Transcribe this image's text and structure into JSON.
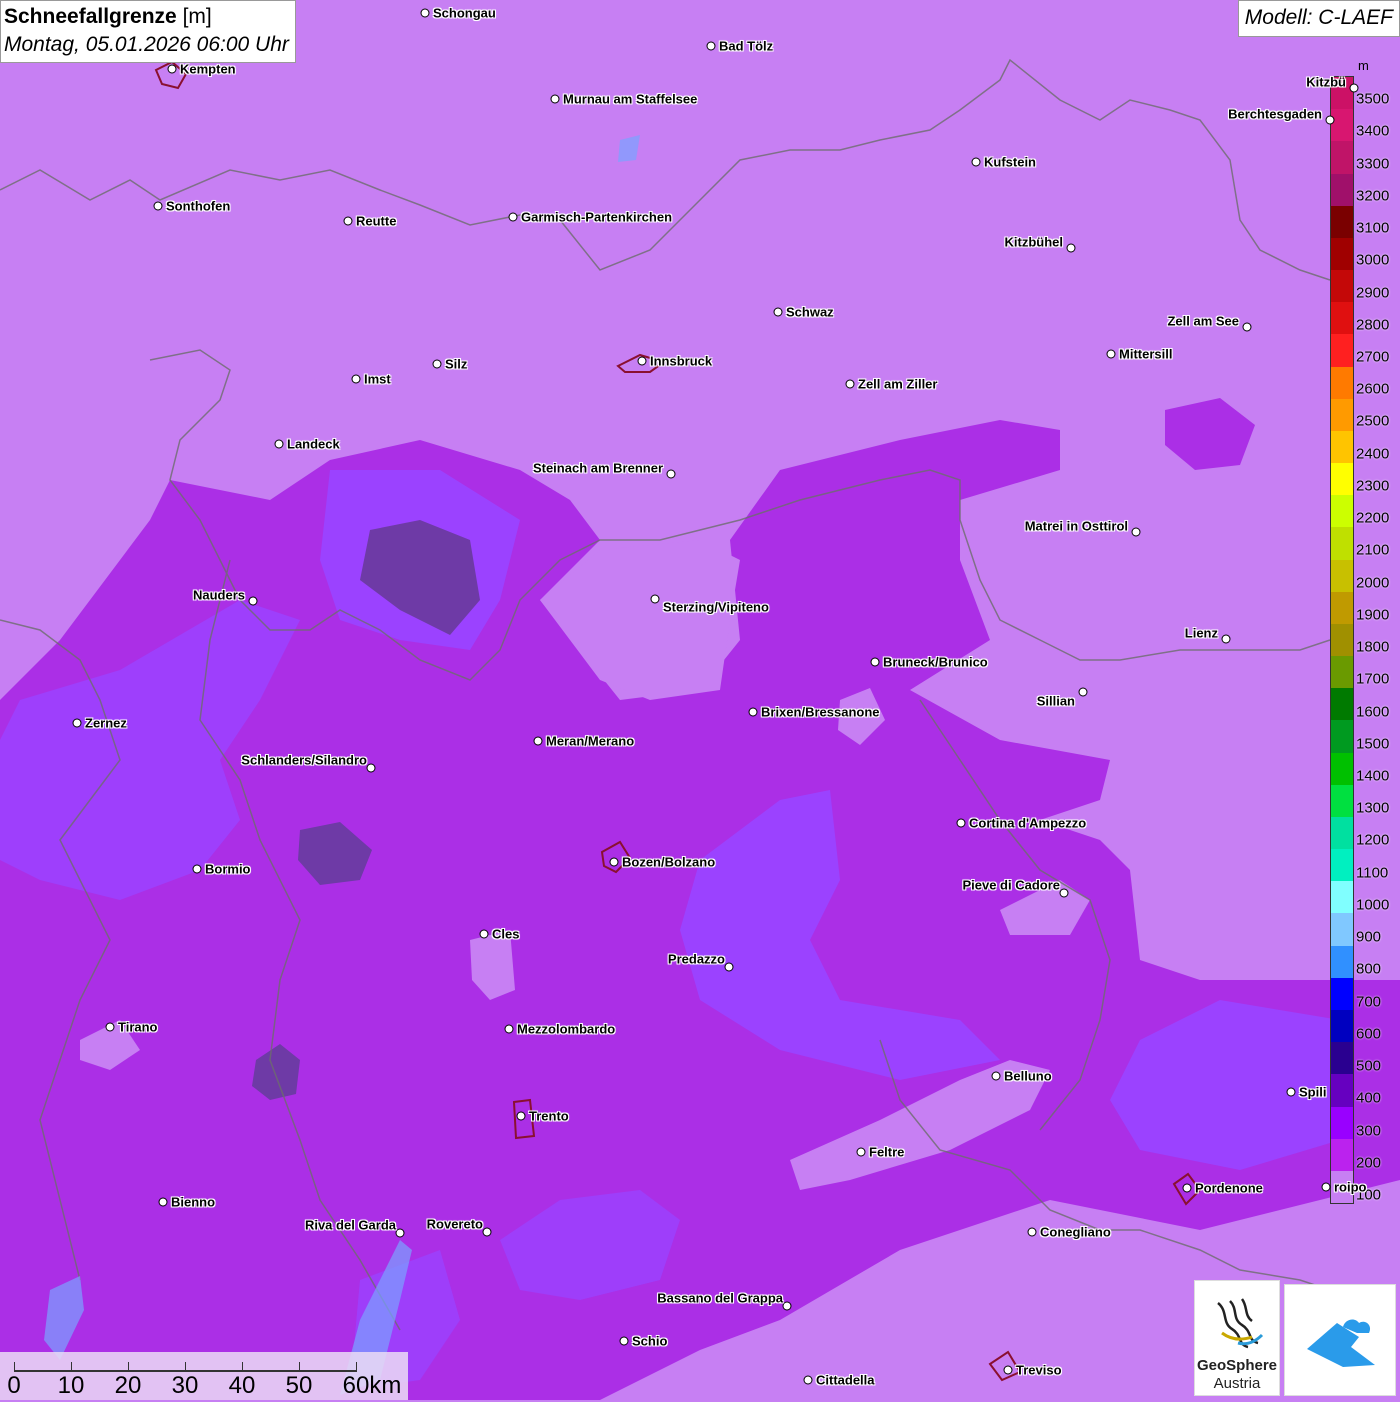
{
  "title": {
    "main": "Schneefallgrenze",
    "unit": "[m]",
    "subtitle": "Montag, 05.01.2026 06:00 Uhr"
  },
  "model": "Modell: C-LAEF",
  "legend": {
    "unit": "m",
    "labels": [
      "3500",
      "3400",
      "3300",
      "3200",
      "3100",
      "3000",
      "2900",
      "2800",
      "2700",
      "2600",
      "2500",
      "2400",
      "2300",
      "2200",
      "2100",
      "2000",
      "1900",
      "1800",
      "1700",
      "1600",
      "1500",
      "1400",
      "1300",
      "1200",
      "1100",
      "1000",
      "900",
      "800",
      "700",
      "600",
      "500",
      "400",
      "300",
      "200",
      "100"
    ],
    "colors": [
      "#cc1166",
      "#d81670",
      "#c01468",
      "#a0106a",
      "#7a0000",
      "#a00000",
      "#c40808",
      "#e01010",
      "#ff2020",
      "#ff7a00",
      "#ff9a00",
      "#ffc400",
      "#ffff00",
      "#ccff00",
      "#bfe000",
      "#c8c000",
      "#c09a00",
      "#a09000",
      "#6a9a00",
      "#007a00",
      "#009a20",
      "#00c000",
      "#00e040",
      "#00e0a0",
      "#00f0c0",
      "#80ffff",
      "#80c8ff",
      "#3090ff",
      "#0000ff",
      "#0000c0",
      "#2a0090",
      "#6600c0",
      "#9900ff",
      "#bb22ee",
      "#c77ff3"
    ]
  },
  "cities": [
    {
      "name": "Schongau"
    },
    {
      "name": "Bad Tölz"
    },
    {
      "name": "Kempten"
    },
    {
      "name": "Murnau am Staffelsee"
    },
    {
      "name": "Berchtesgaden"
    },
    {
      "name": "Kufstein"
    },
    {
      "name": "Sonthofen"
    },
    {
      "name": "Reutte"
    },
    {
      "name": "Garmisch-Partenkirchen"
    },
    {
      "name": "Kitzbühel"
    },
    {
      "name": "Schwaz"
    },
    {
      "name": "Zell am See"
    },
    {
      "name": "Mittersill"
    },
    {
      "name": "Innsbruck"
    },
    {
      "name": "Imst"
    },
    {
      "name": "Silz"
    },
    {
      "name": "Zell am Ziller"
    },
    {
      "name": "Landeck"
    },
    {
      "name": "Steinach am Brenner"
    },
    {
      "name": "Matrei in Osttirol"
    },
    {
      "name": "Nauders"
    },
    {
      "name": "Sterzing/Vipiteno"
    },
    {
      "name": "Lienz"
    },
    {
      "name": "Bruneck/Brunico"
    },
    {
      "name": "Sillian"
    },
    {
      "name": "Zernez"
    },
    {
      "name": "Brixen/Bressanone"
    },
    {
      "name": "Meran/Merano"
    },
    {
      "name": "Schlanders/Silandro"
    },
    {
      "name": "Cortina d'Ampezzo"
    },
    {
      "name": "Bozen/Bolzano"
    },
    {
      "name": "Bormio"
    },
    {
      "name": "Pieve di Cadore"
    },
    {
      "name": "Cles"
    },
    {
      "name": "Predazzo"
    },
    {
      "name": "Tirano"
    },
    {
      "name": "Mezzolombardo"
    },
    {
      "name": "Belluno"
    },
    {
      "name": "Spili"
    },
    {
      "name": "Trento"
    },
    {
      "name": "Feltre"
    },
    {
      "name": "Pordenone"
    },
    {
      "name": "Bienno"
    },
    {
      "name": "Riva del Garda"
    },
    {
      "name": "Rovereto"
    },
    {
      "name": "Conegliano"
    },
    {
      "name": "Bassano del Grappa"
    },
    {
      "name": "Schio"
    },
    {
      "name": "Treviso"
    },
    {
      "name": "Cittadella"
    },
    {
      "name": "Kitzbü"
    },
    {
      "name": "roipo"
    }
  ],
  "scale": {
    "labels": [
      "0",
      "10",
      "20",
      "30",
      "40",
      "50",
      "60km"
    ]
  },
  "logos": {
    "geosphere_line1": "GeoSphere",
    "geosphere_line2": "Austria"
  }
}
